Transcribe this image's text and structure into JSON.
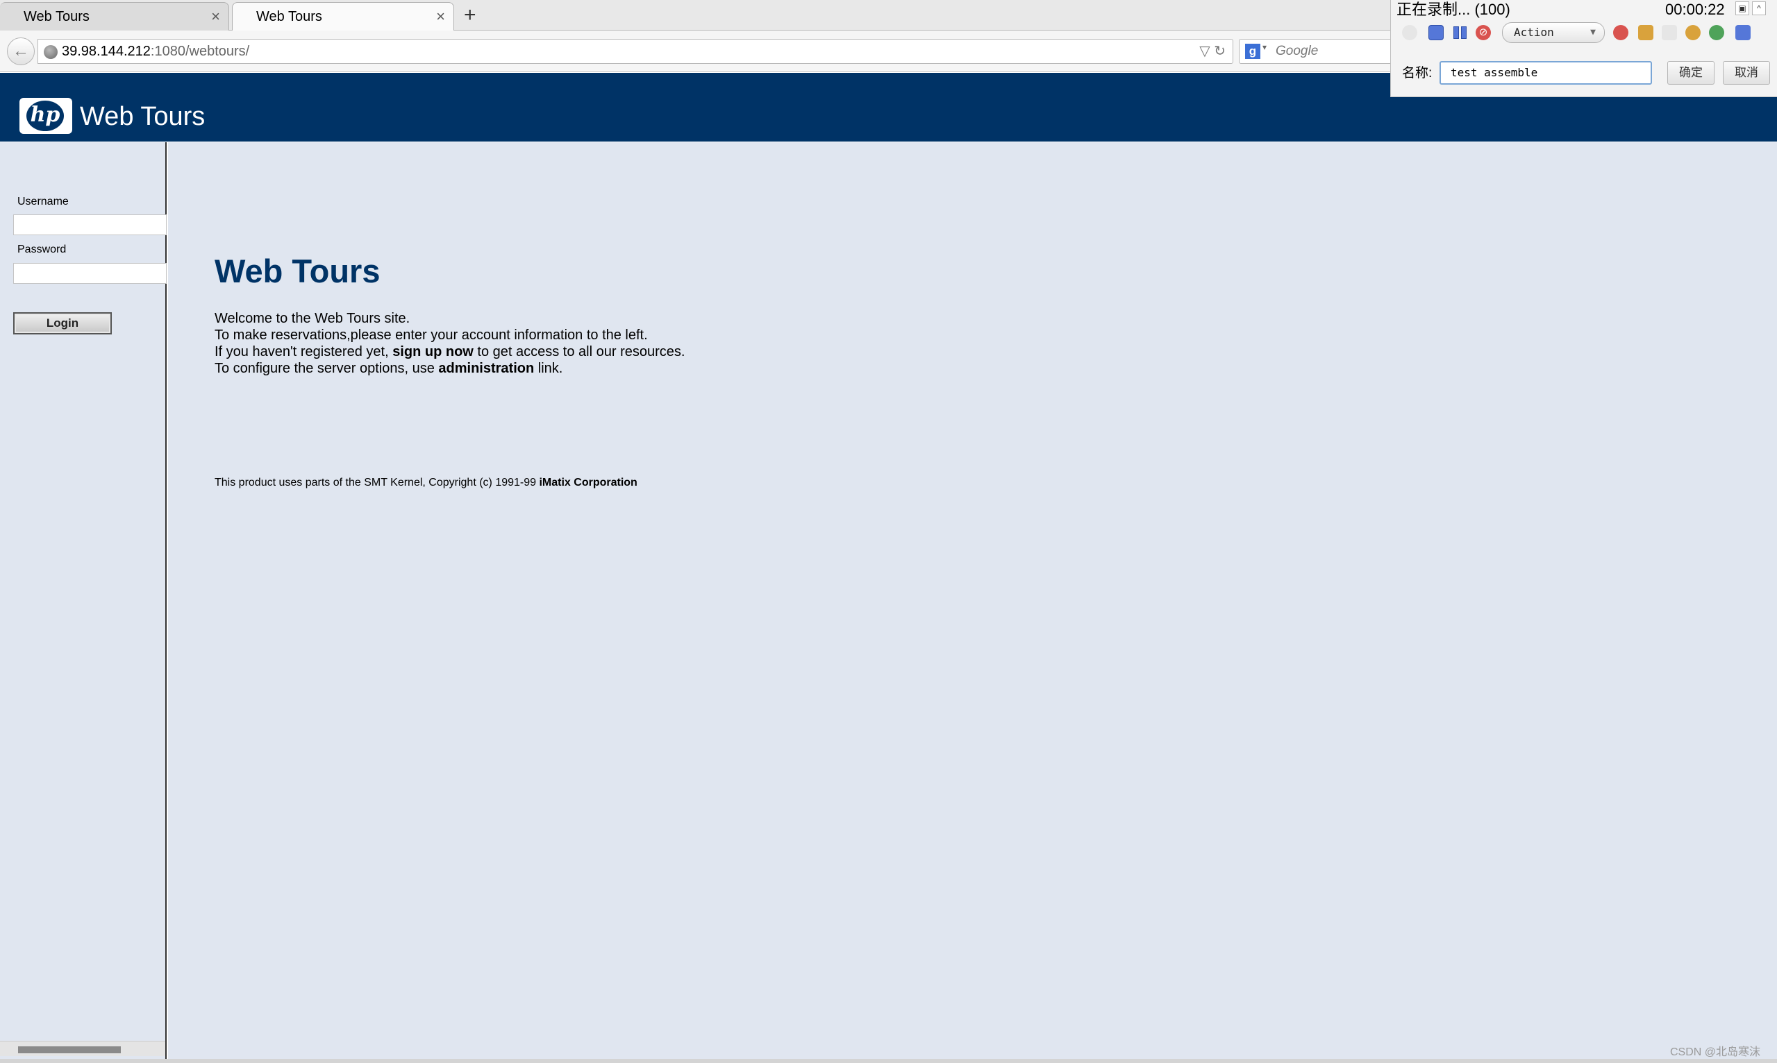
{
  "browser": {
    "tabs": [
      {
        "label": "Web Tours",
        "close": "×",
        "active": false
      },
      {
        "label": "Web Tours",
        "close": "×",
        "active": true
      }
    ],
    "new_tab": "+",
    "back_arrow": "←",
    "url_host": "39.98.144.212",
    "url_rest": ":1080/webtours/",
    "url_icons": "▽ ↻",
    "search_engine_icon": "g",
    "search_caret": "▾",
    "search_placeholder": "Google"
  },
  "header": {
    "logo_text": "hp",
    "brand": "Web Tours",
    "color": "#003366"
  },
  "sidebar": {
    "username_label": "Username",
    "username_value": "",
    "password_label": "Password",
    "password_value": "",
    "login_label": "Login"
  },
  "main": {
    "title": "Web Tours",
    "line1": "Welcome to the Web Tours site.",
    "line2": "To make reservations,please enter your account information to the left.",
    "line3_pre": "If you haven't registered yet, ",
    "line3_link": "sign up now",
    "line3_post": " to get access to all our resources.",
    "line4_pre": "To configure the server options, use ",
    "line4_link": "administration",
    "line4_post": " link.",
    "copyright_pre": "This product uses parts of the SMT Kernel, Copyright (c) 1991-99 ",
    "copyright_link": "iMatix Corporation",
    "background": "#e0e6f0"
  },
  "recorder": {
    "status": "正在录制... (100)",
    "time": "00:00:22",
    "pin_icon": "▣",
    "collapse_icon": "^",
    "cancel_icon": "⊘",
    "action_select": "Action",
    "action_caret": "▼",
    "name_label": "名称:",
    "name_value": "test assemble",
    "ok_label": "确定",
    "cancel_label": "取消"
  },
  "watermark": "CSDN @北岛寒沫"
}
